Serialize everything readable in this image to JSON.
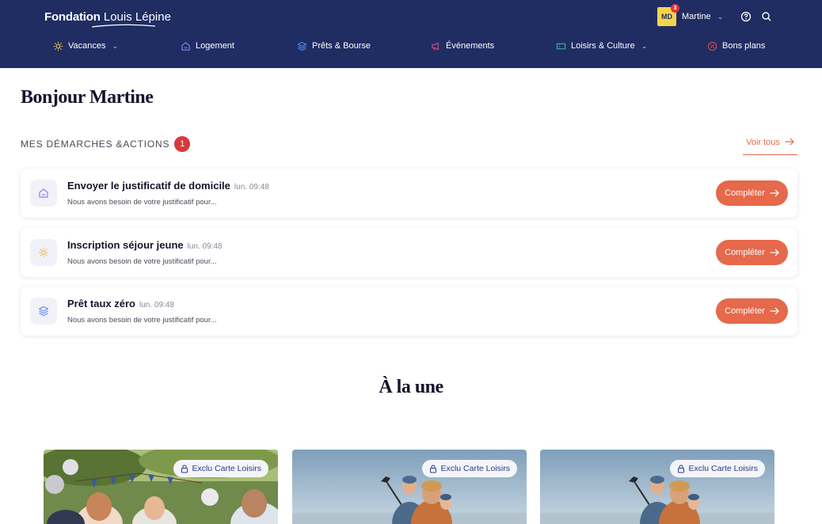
{
  "header": {
    "logo_bold": "Fondation",
    "logo_light": "Louis Lépine",
    "user": {
      "initials": "MD",
      "notification_count": "3",
      "name": "Martine"
    },
    "nav": [
      {
        "label": "Vacances",
        "icon": "sun-icon",
        "has_dropdown": true
      },
      {
        "label": "Logement",
        "icon": "home-icon",
        "has_dropdown": false
      },
      {
        "label": "Prêts & Bourse",
        "icon": "layers-icon",
        "has_dropdown": false
      },
      {
        "label": "Événements",
        "icon": "megaphone-icon",
        "has_dropdown": false
      },
      {
        "label": "Loisirs & Culture",
        "icon": "ticket-icon",
        "has_dropdown": true
      },
      {
        "label": "Bons plans",
        "icon": "discount-icon",
        "has_dropdown": false
      }
    ]
  },
  "greeting": "Bonjour Martine",
  "actions_section": {
    "title": "MES DÉMARCHES &ACTIONS",
    "count": "1",
    "see_all": "Voir tous"
  },
  "actions": [
    {
      "title": "Envoyer le justificatif de domicile",
      "time": "lun. 09:48",
      "description": "Nous avons besoin de votre justificatif pour...",
      "icon": "home-icon",
      "button": "Compléter"
    },
    {
      "title": "Inscription séjour jeune",
      "time": "lun. 09:48",
      "description": "Nous avons besoin de votre justificatif pour...",
      "icon": "sun-icon",
      "button": "Compléter"
    },
    {
      "title": "Prêt taux zéro",
      "time": "lun. 09:48",
      "description": "Nous avons besoin de votre justificatif pour...",
      "icon": "layers-icon",
      "button": "Compléter"
    }
  ],
  "featured": {
    "title": "À la une",
    "cards": [
      {
        "tag": "Exclu Carte Loisirs",
        "image": "kids-party-photo"
      },
      {
        "tag": "Exclu Carte Loisirs",
        "image": "family-selfie-photo"
      },
      {
        "tag": "Exclu Carte Loisirs",
        "image": "family-selfie-photo"
      }
    ]
  },
  "colors": {
    "header_bg": "#1f2d63",
    "accent": "#e5694a",
    "badge": "#d9383a"
  }
}
